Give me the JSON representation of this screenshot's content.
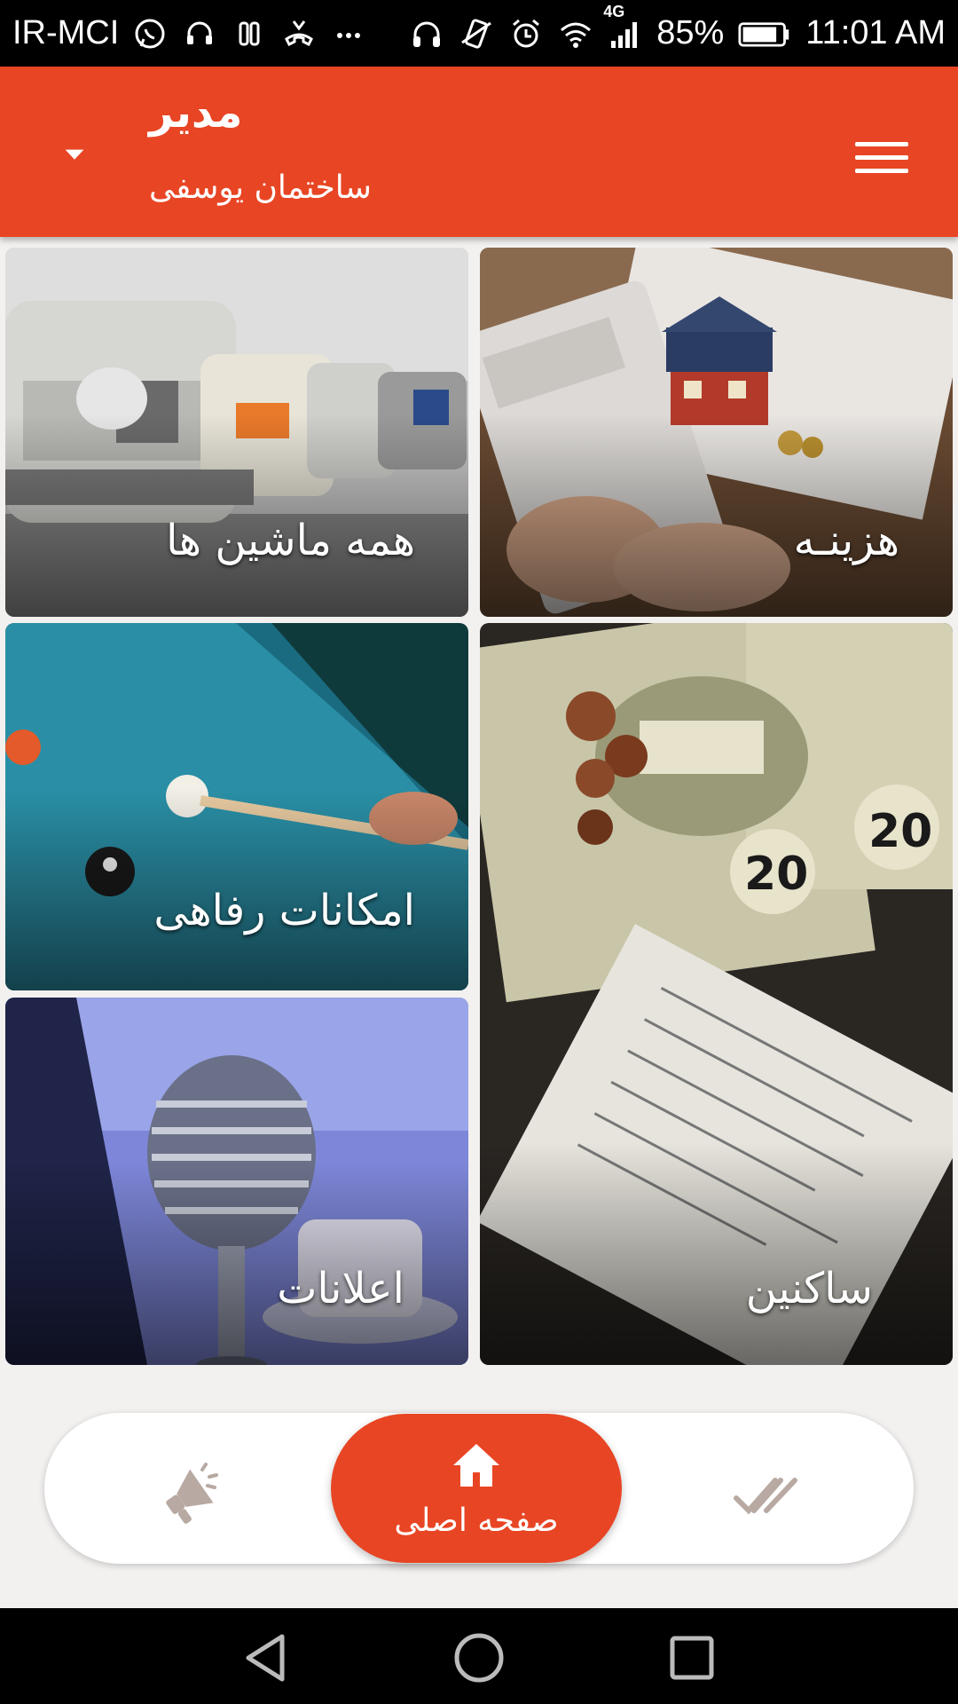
{
  "status_bar": {
    "carrier": "IR-MCI",
    "network": "4G",
    "battery": "85%",
    "time": "11:01 AM",
    "icons": [
      "whatsapp-icon",
      "headset-icon",
      "sim-icon",
      "missed-call-icon",
      "more-icon",
      "headphones-icon",
      "vibrate-icon",
      "alarm-icon",
      "wifi-icon",
      "signal-icon",
      "battery-icon"
    ]
  },
  "toolbar": {
    "title": "مدیر",
    "subtitle": "ساختمان یوسفی",
    "menu_icon": "hamburger-menu-icon",
    "dropdown_icon": "caret-down-icon"
  },
  "tiles": [
    {
      "label": "هزینـه",
      "image": "calculator-house-photo"
    },
    {
      "label": "همه ماشین ها",
      "image": "parked-cars-photo"
    },
    {
      "label": "امکانات رفاهی",
      "image": "billiards-photo"
    },
    {
      "label": "ساکنین",
      "image": "money-receipt-photo"
    },
    {
      "label": "اعلانات",
      "image": "microphone-photo"
    }
  ],
  "bottom_nav": {
    "home_label": "صفحه اصلی",
    "home_icon": "home-icon",
    "left_icon": "megaphone-icon",
    "right_icon": "double-check-icon"
  },
  "colors": {
    "accent": "#e84524",
    "background": "#f3f1f0",
    "nav_icon": "#b8a9a2"
  }
}
